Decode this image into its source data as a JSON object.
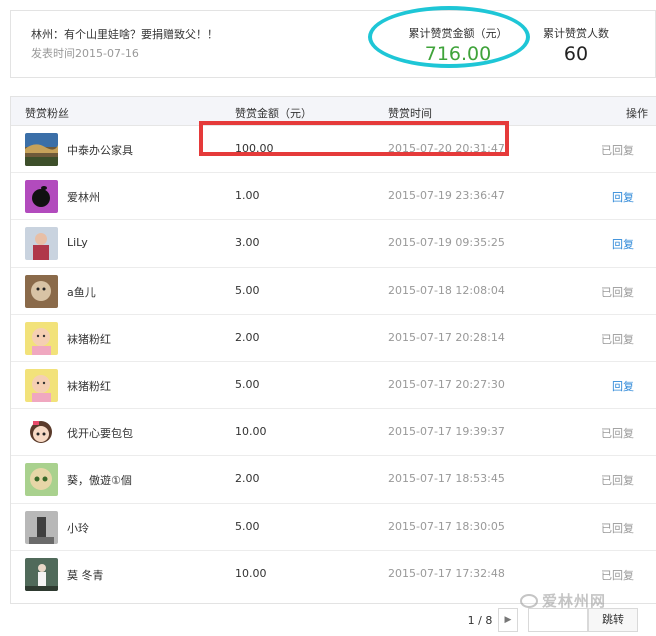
{
  "article": {
    "title": "林州：有个山里娃啥？要捐赠致父！！",
    "publish_time": "发表时间2015-07-16"
  },
  "stats": {
    "amount_label": "累计赞赏金额（元）",
    "amount_value": "716.00",
    "count_label": "累计赞赏人数",
    "count_value": "60",
    "amount_color": "#3fa33a"
  },
  "table": {
    "headers": {
      "fan": "赞赏粉丝",
      "amount": "赞赏金额（元）",
      "time": "赞赏时间",
      "op": "操作"
    },
    "rows": [
      {
        "name": "中泰办公家具",
        "amount": "100.00",
        "time": "2015-07-20 20:31:47",
        "op": "已回复",
        "op_active": false,
        "avatar": "landscape"
      },
      {
        "name": "爱林州",
        "amount": "1.00",
        "time": "2015-07-19 23:36:47",
        "op": "回复",
        "op_active": true,
        "avatar": "apple"
      },
      {
        "name": "LiLy",
        "amount": "3.00",
        "time": "2015-07-19 09:35:25",
        "op": "回复",
        "op_active": true,
        "avatar": "person"
      },
      {
        "name": "a鱼儿",
        "amount": "5.00",
        "time": "2015-07-18 12:08:04",
        "op": "已回复",
        "op_active": false,
        "avatar": "pet"
      },
      {
        "name": "袜猪粉红",
        "amount": "2.00",
        "time": "2015-07-17 20:28:14",
        "op": "已回复",
        "op_active": false,
        "avatar": "baby"
      },
      {
        "name": "袜猪粉红",
        "amount": "5.00",
        "time": "2015-07-17 20:27:30",
        "op": "回复",
        "op_active": true,
        "avatar": "baby"
      },
      {
        "name": "伐开心要包包",
        "amount": "10.00",
        "time": "2015-07-17 19:39:37",
        "op": "已回复",
        "op_active": false,
        "avatar": "cartoon"
      },
      {
        "name": "葵，傲遊①個",
        "amount": "2.00",
        "time": "2015-07-17 18:53:45",
        "op": "已回复",
        "op_active": false,
        "avatar": "doll"
      },
      {
        "name": "小玲",
        "amount": "5.00",
        "time": "2015-07-17 18:30:05",
        "op": "已回复",
        "op_active": false,
        "avatar": "street"
      },
      {
        "name": "莫 冬青",
        "amount": "10.00",
        "time": "2015-07-17 17:32:48",
        "op": "已回复",
        "op_active": false,
        "avatar": "figure"
      }
    ]
  },
  "pagination": {
    "indicator": "1 / 8",
    "next_icon": "triangle-right-icon",
    "go_label": "跳转"
  },
  "watermark": "爱林州网"
}
